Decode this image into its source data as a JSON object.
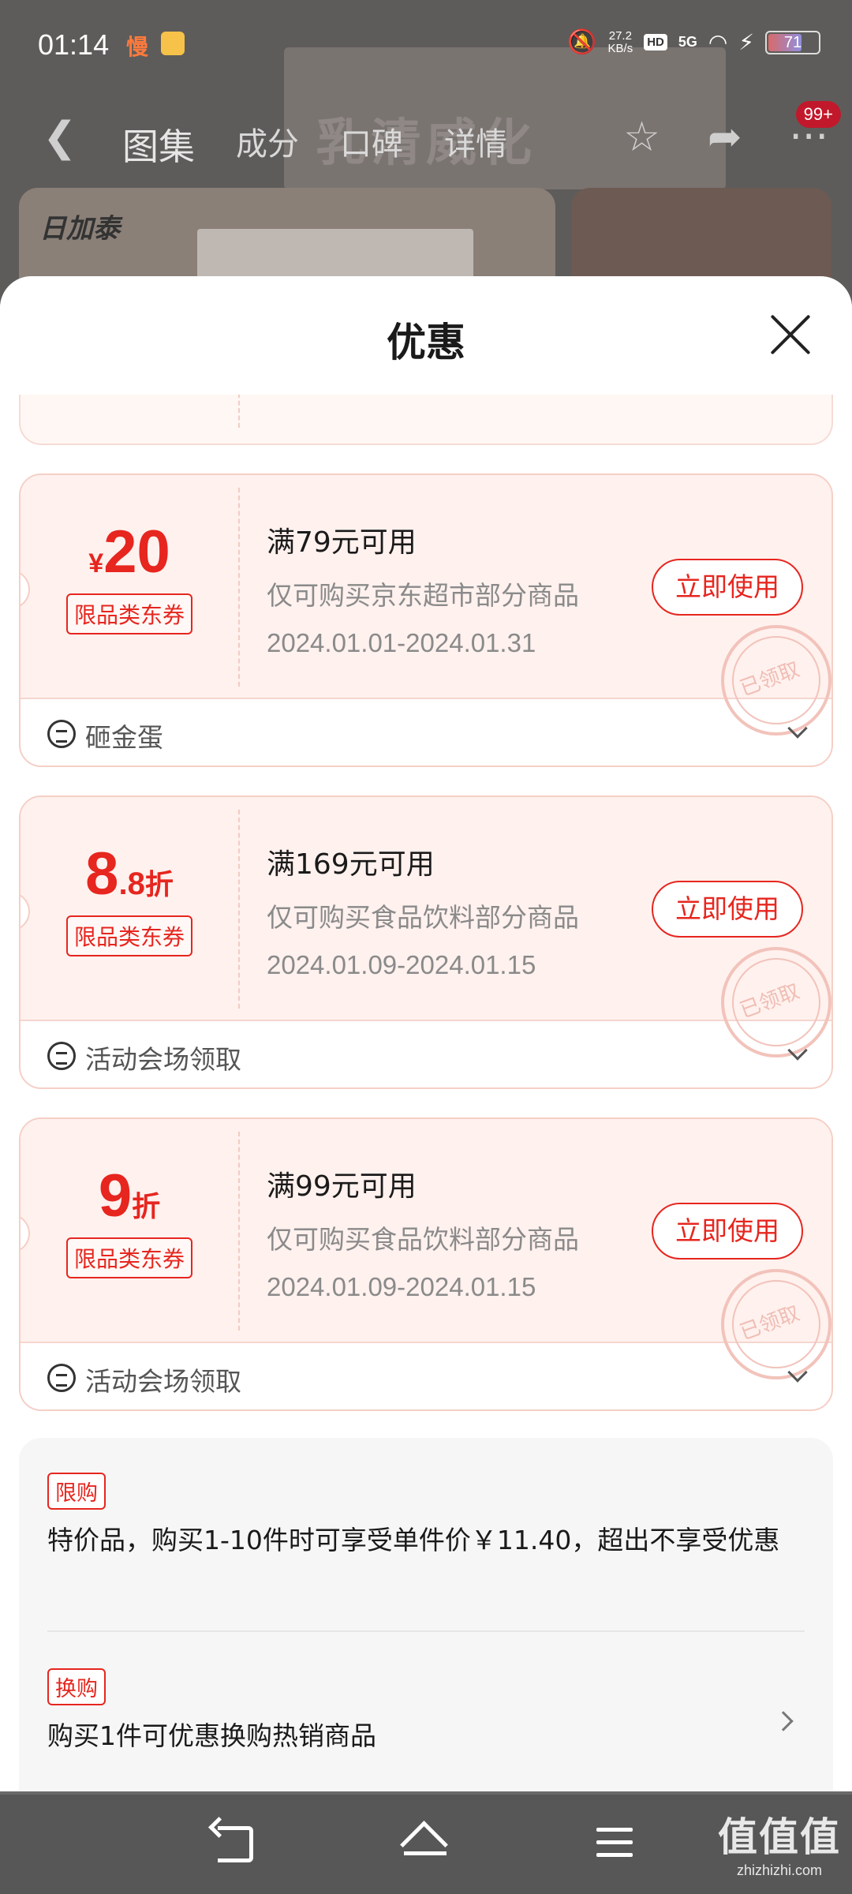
{
  "status_bar": {
    "time": "01:14",
    "slow_label": "慢",
    "net_speed": "27.2",
    "net_unit": "KB/s",
    "hd": "HD",
    "network": "5G",
    "battery": "71"
  },
  "background_page": {
    "tabs": [
      "图集",
      "成分",
      "口碑",
      "详情"
    ],
    "badge": "99+",
    "brand": "日加泰",
    "hero_text": "乳清威化"
  },
  "sheet": {
    "title": "优惠"
  },
  "coupons": [
    {
      "currency": "¥",
      "amount": "20",
      "tag": "限品类东券",
      "condition": "满79元可用",
      "scope": "仅可购买京东超市部分商品",
      "dates": "2024.01.01-2024.01.31",
      "button": "立即使用",
      "stamp": "已领取",
      "source": "砸金蛋"
    },
    {
      "amount_int": "8",
      "amount_dec": ".8",
      "unit": "折",
      "tag": "限品类东券",
      "condition": "满169元可用",
      "scope": "仅可购买食品饮料部分商品",
      "dates": "2024.01.09-2024.01.15",
      "button": "立即使用",
      "stamp": "已领取",
      "source": "活动会场领取"
    },
    {
      "amount_int": "9",
      "unit": "折",
      "tag": "限品类东券",
      "condition": "满99元可用",
      "scope": "仅可购买食品饮料部分商品",
      "dates": "2024.01.09-2024.01.15",
      "button": "立即使用",
      "stamp": "已领取",
      "source": "活动会场领取"
    }
  ],
  "promotions": [
    {
      "tag": "限购",
      "text": "特价品，购买1-10件时可享受单件价￥11.40，超出不享受优惠"
    },
    {
      "tag": "换购",
      "text": "购买1件可优惠换购热销商品"
    }
  ],
  "watermark": {
    "big": "值值值",
    "small": "zhizhizhi.com"
  },
  "colors": {
    "accent": "#e6261f",
    "coupon_bg": "#fff1ee"
  }
}
